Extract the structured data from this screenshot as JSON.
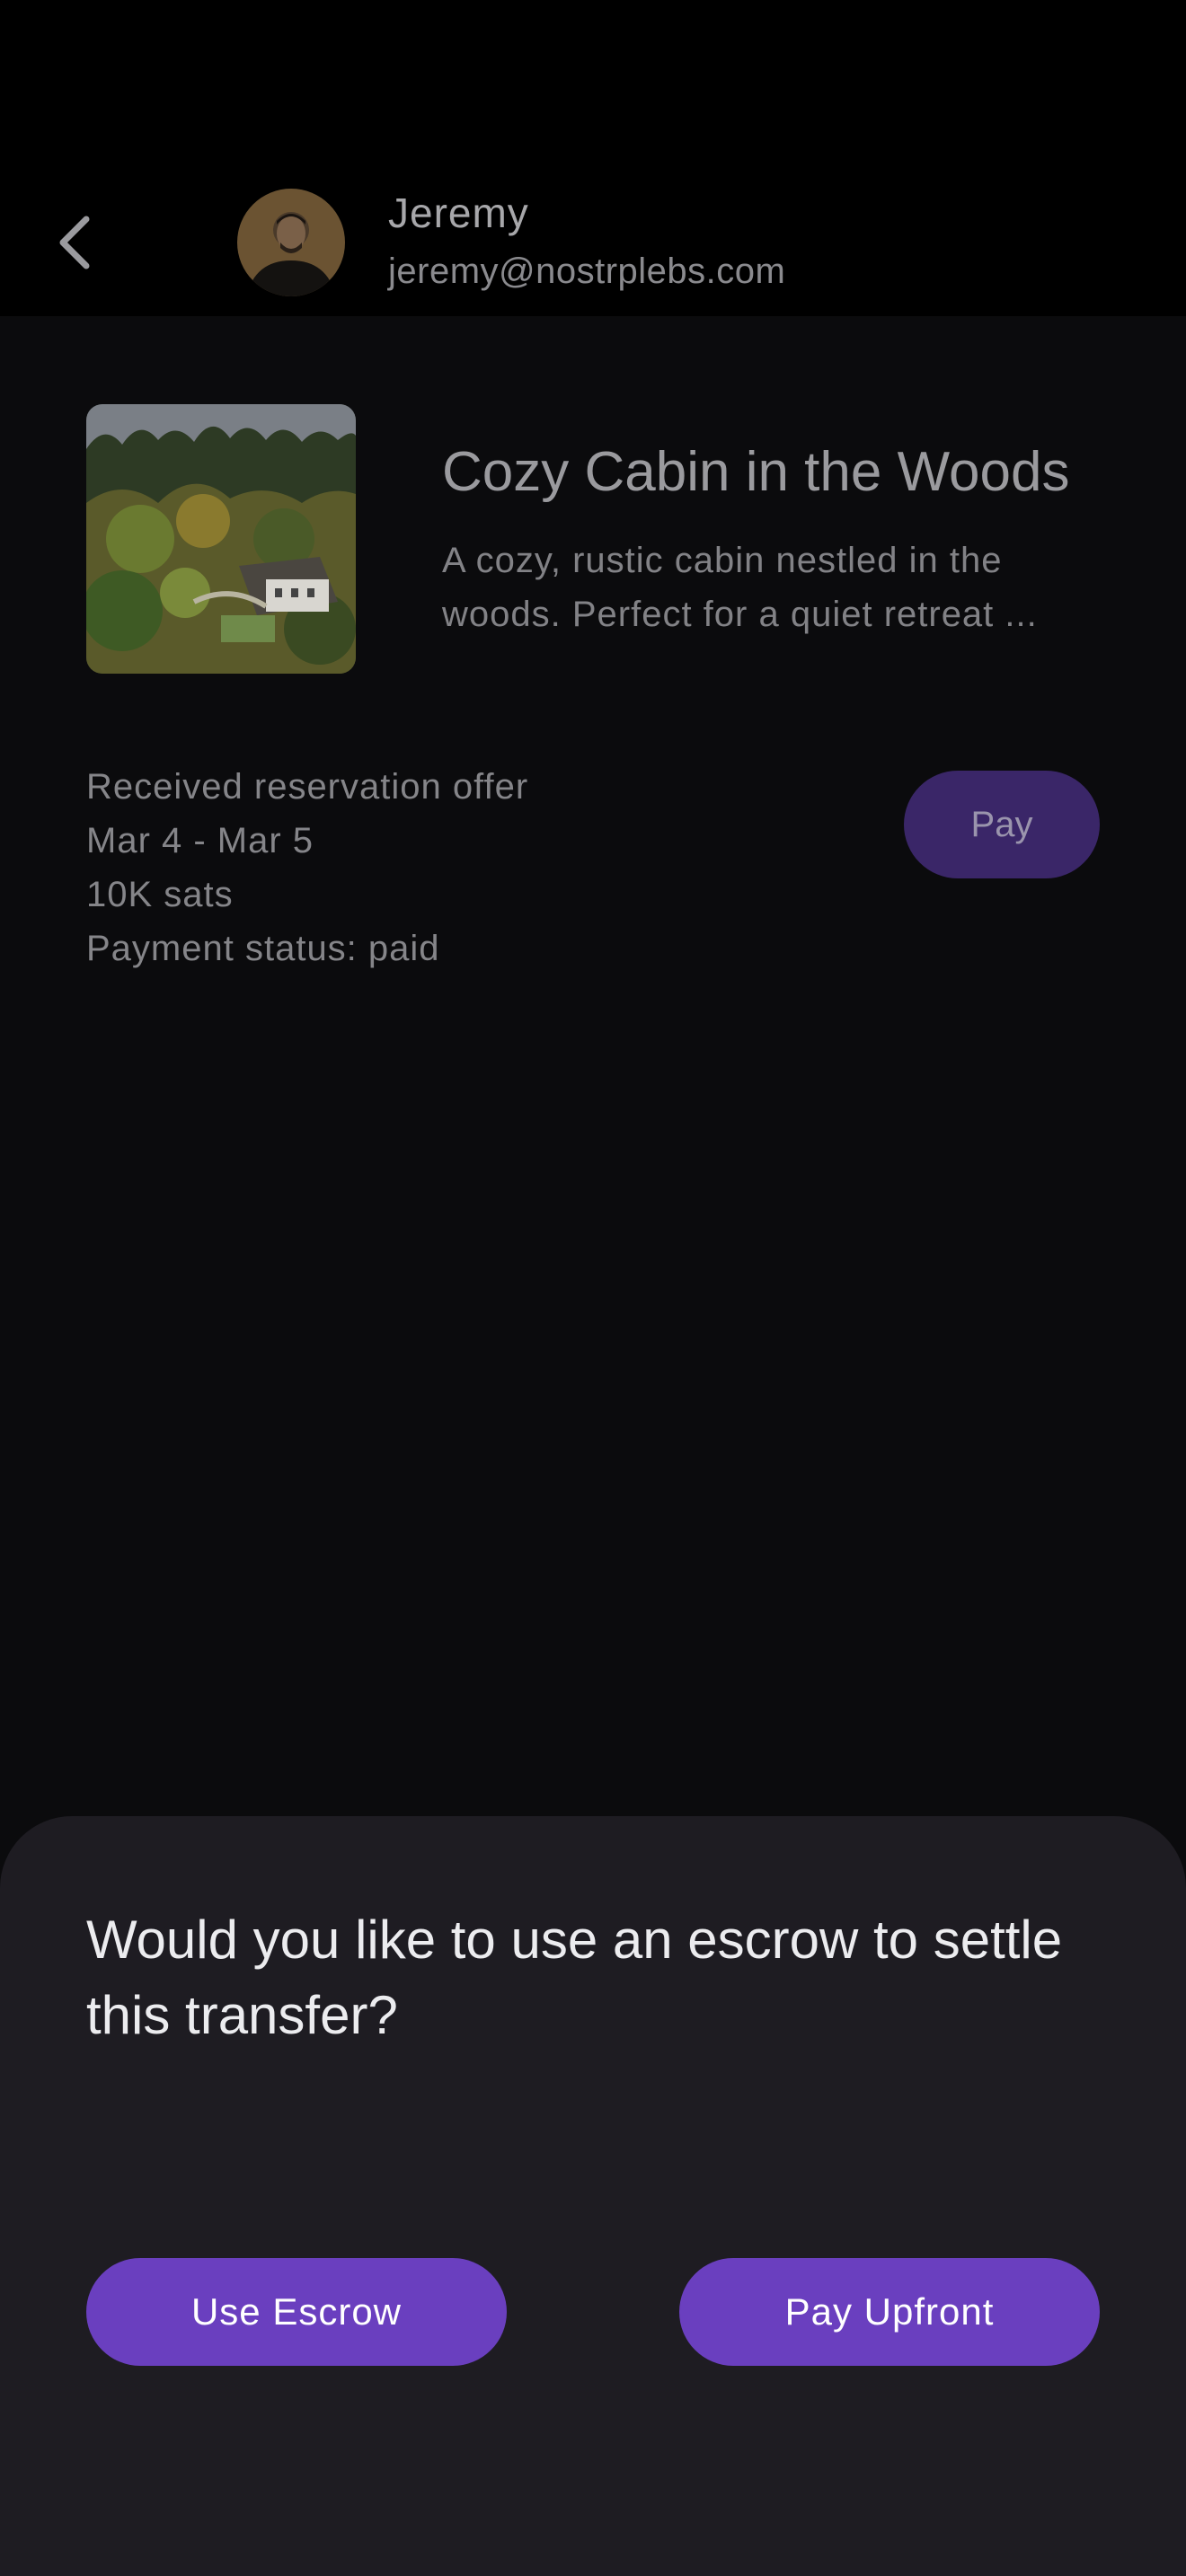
{
  "header": {
    "name": "Jeremy",
    "email": "jeremy@nostrplebs.com",
    "back_icon": "chevron-left-icon"
  },
  "listing": {
    "title": "Cozy Cabin in the Woods",
    "description_line1": "A cozy, rustic cabin nestled in the",
    "description_line2": "woods. Perfect for a quiet retreat ..."
  },
  "offer": {
    "status_line": "Received reservation offer",
    "dates": "Mar 4 - Mar 5",
    "amount": "10K sats",
    "payment_status": "Payment status: paid",
    "pay_label": "Pay"
  },
  "sheet": {
    "question": "Would you like to use an escrow to settle this transfer?",
    "use_escrow_label": "Use Escrow",
    "pay_upfront_label": "Pay Upfront"
  },
  "colors": {
    "accent": "#6a3fbf",
    "accent_dimmed": "#3a2668",
    "sheet_bg": "#1e1c22",
    "background": "#0b0b0d"
  }
}
